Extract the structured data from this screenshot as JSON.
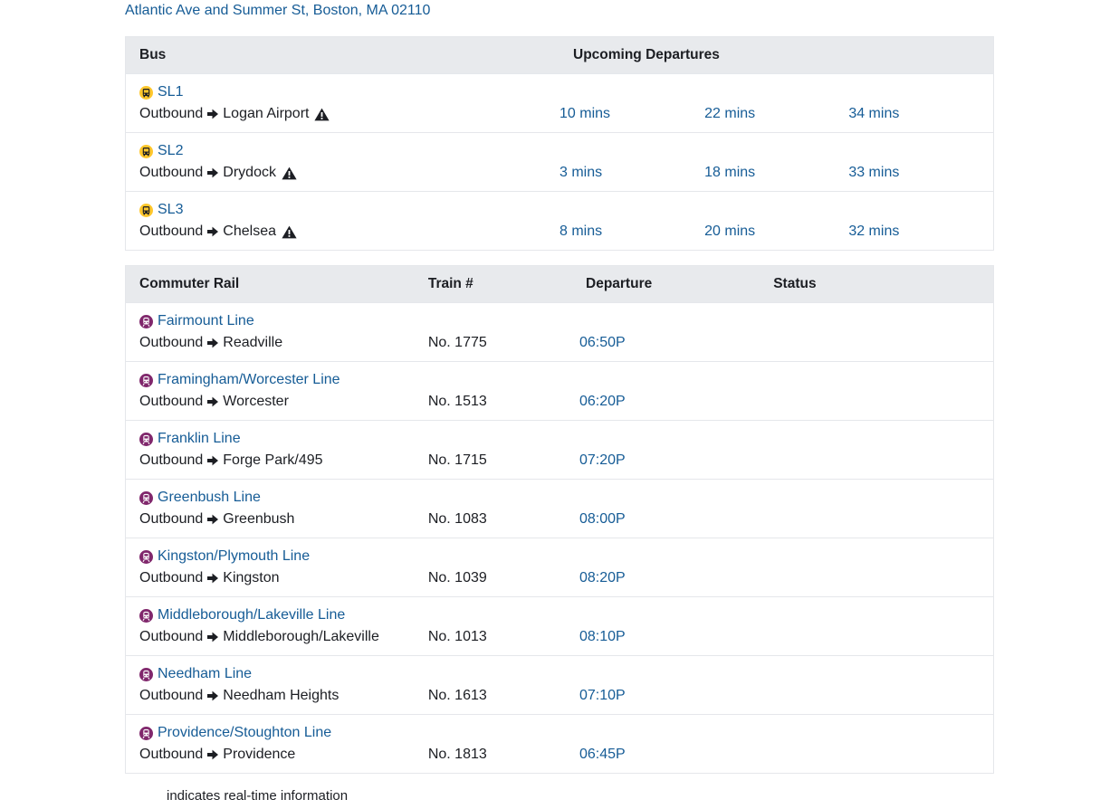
{
  "address": "Atlantic Ave and Summer St, Boston, MA 02110",
  "bus": {
    "headers": {
      "route": "Bus",
      "departures": "Upcoming Departures"
    },
    "rows": [
      {
        "route": "SL1",
        "direction": "Outbound",
        "destination": "Logan Airport",
        "times": [
          "10 mins",
          "22 mins",
          "34 mins"
        ]
      },
      {
        "route": "SL2",
        "direction": "Outbound",
        "destination": "Drydock",
        "times": [
          "3 mins",
          "18 mins",
          "33 mins"
        ]
      },
      {
        "route": "SL3",
        "direction": "Outbound",
        "destination": "Chelsea",
        "times": [
          "8 mins",
          "20 mins",
          "32 mins"
        ]
      }
    ]
  },
  "rail": {
    "headers": {
      "route": "Commuter Rail",
      "train": "Train #",
      "departure": "Departure",
      "status": "Status"
    },
    "rows": [
      {
        "route": "Fairmount Line",
        "direction": "Outbound",
        "destination": "Readville",
        "train": "No. 1775",
        "departure": "06:50P",
        "status": ""
      },
      {
        "route": "Framingham/Worcester Line",
        "direction": "Outbound",
        "destination": "Worcester",
        "train": "No. 1513",
        "departure": "06:20P",
        "status": ""
      },
      {
        "route": "Franklin Line",
        "direction": "Outbound",
        "destination": "Forge Park/495",
        "train": "No. 1715",
        "departure": "07:20P",
        "status": ""
      },
      {
        "route": "Greenbush Line",
        "direction": "Outbound",
        "destination": "Greenbush",
        "train": "No. 1083",
        "departure": "08:00P",
        "status": ""
      },
      {
        "route": "Kingston/Plymouth Line",
        "direction": "Outbound",
        "destination": "Kingston",
        "train": "No. 1039",
        "departure": "08:20P",
        "status": ""
      },
      {
        "route": "Middleborough/Lakeville Line",
        "direction": "Outbound",
        "destination": "Middleborough/Lakeville",
        "train": "No. 1013",
        "departure": "08:10P",
        "status": ""
      },
      {
        "route": "Needham Line",
        "direction": "Outbound",
        "destination": "Needham Heights",
        "train": "No. 1613",
        "departure": "07:10P",
        "status": ""
      },
      {
        "route": "Providence/Stoughton Line",
        "direction": "Outbound",
        "destination": "Providence",
        "train": "No. 1813",
        "departure": "06:45P",
        "status": ""
      }
    ]
  },
  "footnote": "indicates real-time information",
  "colors": {
    "link": "#165c96",
    "bus_icon": "#ffc72c",
    "rail_icon": "#80276c",
    "header_bg": "#e8eaed"
  },
  "icons": {
    "bus": "bus-icon",
    "rail": "commuter-rail-icon",
    "arrow": "arrow-right-icon",
    "alert": "alert-icon"
  }
}
